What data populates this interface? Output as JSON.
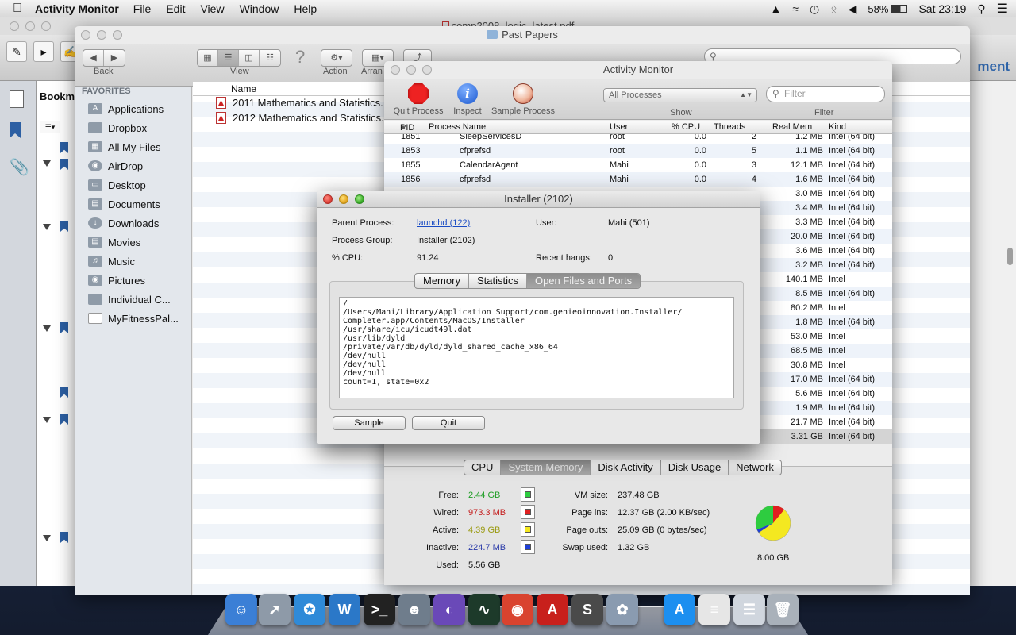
{
  "menubar": {
    "app_name": "Activity Monitor",
    "items": [
      "File",
      "Edit",
      "View",
      "Window",
      "Help"
    ],
    "battery": "58%",
    "clock": "Sat 23:19"
  },
  "pdf_app": {
    "title": "comp2008_logic_latest.pdf",
    "bookmarks_tab": "Bookm",
    "right_label": "ment"
  },
  "finder": {
    "title": "Past Papers",
    "back_label": "Back",
    "view_label": "View",
    "action_label": "Action",
    "arrange_label": "Arran",
    "favorites_heading": "FAVORITES",
    "favorites": [
      {
        "label": "Applications",
        "icon": "applications-icon"
      },
      {
        "label": "Dropbox",
        "icon": "folder-icon"
      },
      {
        "label": "All My Files",
        "icon": "all-files-icon"
      },
      {
        "label": "AirDrop",
        "icon": "airdrop-icon"
      },
      {
        "label": "Desktop",
        "icon": "desktop-icon"
      },
      {
        "label": "Documents",
        "icon": "documents-icon"
      },
      {
        "label": "Downloads",
        "icon": "downloads-icon"
      },
      {
        "label": "Movies",
        "icon": "movies-icon"
      },
      {
        "label": "Music",
        "icon": "music-icon"
      },
      {
        "label": "Pictures",
        "icon": "pictures-icon"
      },
      {
        "label": "Individual C...",
        "icon": "folder-icon"
      },
      {
        "label": "MyFitnessPal...",
        "icon": "document-icon"
      }
    ],
    "name_header": "Name",
    "files": [
      "2011 Mathematics and Statistics.",
      "2012 Mathematics and Statistics."
    ]
  },
  "activity_monitor": {
    "title": "Activity Monitor",
    "toolbar": {
      "quit": "Quit Process",
      "inspect": "Inspect",
      "sample": "Sample Process",
      "show_value": "All Processes",
      "show_label": "Show",
      "filter_placeholder": "Filter",
      "filter_label": "Filter"
    },
    "columns": {
      "pid": "PID",
      "name": "Process Name",
      "user": "User",
      "cpu": "% CPU",
      "threads": "Threads",
      "mem": "Real Mem",
      "kind": "Kind"
    },
    "rows": [
      {
        "pid": "1851",
        "name": "SleepServicesD",
        "user": "root",
        "cpu": "0.0",
        "threads": "2",
        "mem": "1.2 MB",
        "kind": "Intel (64 bit)"
      },
      {
        "pid": "1853",
        "name": "cfprefsd",
        "user": "root",
        "cpu": "0.0",
        "threads": "5",
        "mem": "1.1 MB",
        "kind": "Intel (64 bit)"
      },
      {
        "pid": "1855",
        "name": "CalendarAgent",
        "user": "Mahi",
        "cpu": "0.0",
        "threads": "3",
        "mem": "12.1 MB",
        "kind": "Intel (64 bit)"
      },
      {
        "pid": "1856",
        "name": "cfprefsd",
        "user": "Mahi",
        "cpu": "0.0",
        "threads": "4",
        "mem": "1.6 MB",
        "kind": "Intel (64 bit)"
      },
      {
        "pid": "",
        "name": "",
        "user": "",
        "cpu": "",
        "threads": "",
        "mem": "3.0 MB",
        "kind": "Intel (64 bit)"
      },
      {
        "pid": "",
        "name": "",
        "user": "",
        "cpu": "",
        "threads": "",
        "mem": "3.4 MB",
        "kind": "Intel (64 bit)"
      },
      {
        "pid": "",
        "name": "",
        "user": "",
        "cpu": "",
        "threads": "",
        "mem": "3.3 MB",
        "kind": "Intel (64 bit)"
      },
      {
        "pid": "",
        "name": "",
        "user": "",
        "cpu": "",
        "threads": "",
        "mem": "20.0 MB",
        "kind": "Intel (64 bit)"
      },
      {
        "pid": "",
        "name": "",
        "user": "",
        "cpu": "",
        "threads": "",
        "mem": "3.6 MB",
        "kind": "Intel (64 bit)"
      },
      {
        "pid": "",
        "name": "",
        "user": "",
        "cpu": "",
        "threads": "",
        "mem": "3.2 MB",
        "kind": "Intel (64 bit)"
      },
      {
        "pid": "",
        "name": "",
        "user": "",
        "cpu": "",
        "threads": "",
        "mem": "140.1 MB",
        "kind": "Intel"
      },
      {
        "pid": "",
        "name": "",
        "user": "",
        "cpu": "",
        "threads": "",
        "mem": "8.5 MB",
        "kind": "Intel (64 bit)"
      },
      {
        "pid": "",
        "name": "",
        "user": "",
        "cpu": "",
        "threads": "",
        "mem": "80.2 MB",
        "kind": "Intel"
      },
      {
        "pid": "",
        "name": "",
        "user": "",
        "cpu": "",
        "threads": "",
        "mem": "1.8 MB",
        "kind": "Intel (64 bit)"
      },
      {
        "pid": "",
        "name": "",
        "user": "",
        "cpu": "",
        "threads": "",
        "mem": "53.0 MB",
        "kind": "Intel"
      },
      {
        "pid": "",
        "name": "",
        "user": "",
        "cpu": "",
        "threads": "",
        "mem": "68.5 MB",
        "kind": "Intel"
      },
      {
        "pid": "",
        "name": "",
        "user": "",
        "cpu": "",
        "threads": "",
        "mem": "30.8 MB",
        "kind": "Intel"
      },
      {
        "pid": "",
        "name": "",
        "user": "",
        "cpu": "",
        "threads": "",
        "mem": "17.0 MB",
        "kind": "Intel (64 bit)"
      },
      {
        "pid": "",
        "name": "",
        "user": "",
        "cpu": "",
        "threads": "",
        "mem": "5.6 MB",
        "kind": "Intel (64 bit)"
      },
      {
        "pid": "",
        "name": "",
        "user": "",
        "cpu": "",
        "threads": "",
        "mem": "1.9 MB",
        "kind": "Intel (64 bit)"
      },
      {
        "pid": "",
        "name": "",
        "user": "",
        "cpu": "",
        "threads": "",
        "mem": "21.7 MB",
        "kind": "Intel (64 bit)"
      },
      {
        "pid": "",
        "name": "",
        "user": "",
        "cpu": "",
        "threads": "",
        "mem": "3.31 GB",
        "kind": "Intel (64 bit)"
      }
    ],
    "tabs": [
      "CPU",
      "System Memory",
      "Disk Activity",
      "Disk Usage",
      "Network"
    ],
    "memory": {
      "free_label": "Free:",
      "free": "2.44 GB",
      "wired_label": "Wired:",
      "wired": "973.3 MB",
      "active_label": "Active:",
      "active": "4.39 GB",
      "inactive_label": "Inactive:",
      "inactive": "224.7 MB",
      "used_label": "Used:",
      "used": "5.56 GB",
      "vm_label": "VM size:",
      "vm": "237.48 GB",
      "pageins_label": "Page ins:",
      "pageins": "12.37 GB (2.00 KB/sec)",
      "pageouts_label": "Page outs:",
      "pageouts": "25.09 GB (0 bytes/sec)",
      "swap_label": "Swap used:",
      "swap": "1.32 GB",
      "total": "8.00 GB",
      "colors": {
        "free": "#2ecc40",
        "wired": "#e02020",
        "active": "#f4e820",
        "inactive": "#1f3fd6"
      }
    }
  },
  "installer": {
    "title": "Installer (2102)",
    "parent_label": "Parent Process:",
    "parent_value": "launchd (122)",
    "user_label": "User:",
    "user_value": "Mahi (501)",
    "group_label": "Process Group:",
    "group_value": "Installer (2102)",
    "cpu_label": "% CPU:",
    "cpu_value": "91.24",
    "hangs_label": "Recent hangs:",
    "hangs_value": "0",
    "tabs": [
      "Memory",
      "Statistics",
      "Open Files and Ports"
    ],
    "files": [
      "/",
      "/Users/Mahi/Library/Application Support/com.genieoinnovation.Installer/",
      "Completer.app/Contents/MacOS/Installer",
      "/usr/share/icu/icudt49l.dat",
      "/usr/lib/dyld",
      "/private/var/db/dyld/dyld_shared_cache_x86_64",
      "/dev/null",
      "/dev/null",
      "/dev/null",
      "count=1, state=0x2"
    ],
    "sample_button": "Sample",
    "quit_button": "Quit"
  },
  "dock": [
    {
      "name": "finder-icon",
      "glyph": "☺",
      "color": "#3b7fd6"
    },
    {
      "name": "launchpad-icon",
      "glyph": "➚",
      "color": "#8e9aa8"
    },
    {
      "name": "safari-icon",
      "glyph": "✪",
      "color": "#2f8ad8"
    },
    {
      "name": "word-icon",
      "glyph": "W",
      "color": "#2b78c8"
    },
    {
      "name": "terminal-icon",
      "glyph": ">_",
      "color": "#222222"
    },
    {
      "name": "robot-app-icon",
      "glyph": "☻",
      "color": "#6f7d8c"
    },
    {
      "name": "eclipse-icon",
      "glyph": "◐",
      "color": "#6a49b8"
    },
    {
      "name": "activity-monitor-icon",
      "glyph": "∿",
      "color": "#1d3a2a"
    },
    {
      "name": "chrome-icon",
      "glyph": "◉",
      "color": "#d9432f"
    },
    {
      "name": "acrobat-icon",
      "glyph": "A",
      "color": "#c8201c"
    },
    {
      "name": "sublime-icon",
      "glyph": "S",
      "color": "#4a4a4a"
    },
    {
      "name": "photos-icon",
      "glyph": "✿",
      "color": "#8a9bb0"
    },
    {
      "name": "app-store-icon",
      "glyph": "A",
      "color": "#1c8ff0"
    },
    {
      "name": "document-stack-icon",
      "glyph": "≡",
      "color": "#e6e6e6"
    },
    {
      "name": "downloads-stack-icon",
      "glyph": "☰",
      "color": "#d0d6de"
    },
    {
      "name": "trash-icon",
      "glyph": "🗑",
      "color": "#a9b1ba"
    }
  ]
}
